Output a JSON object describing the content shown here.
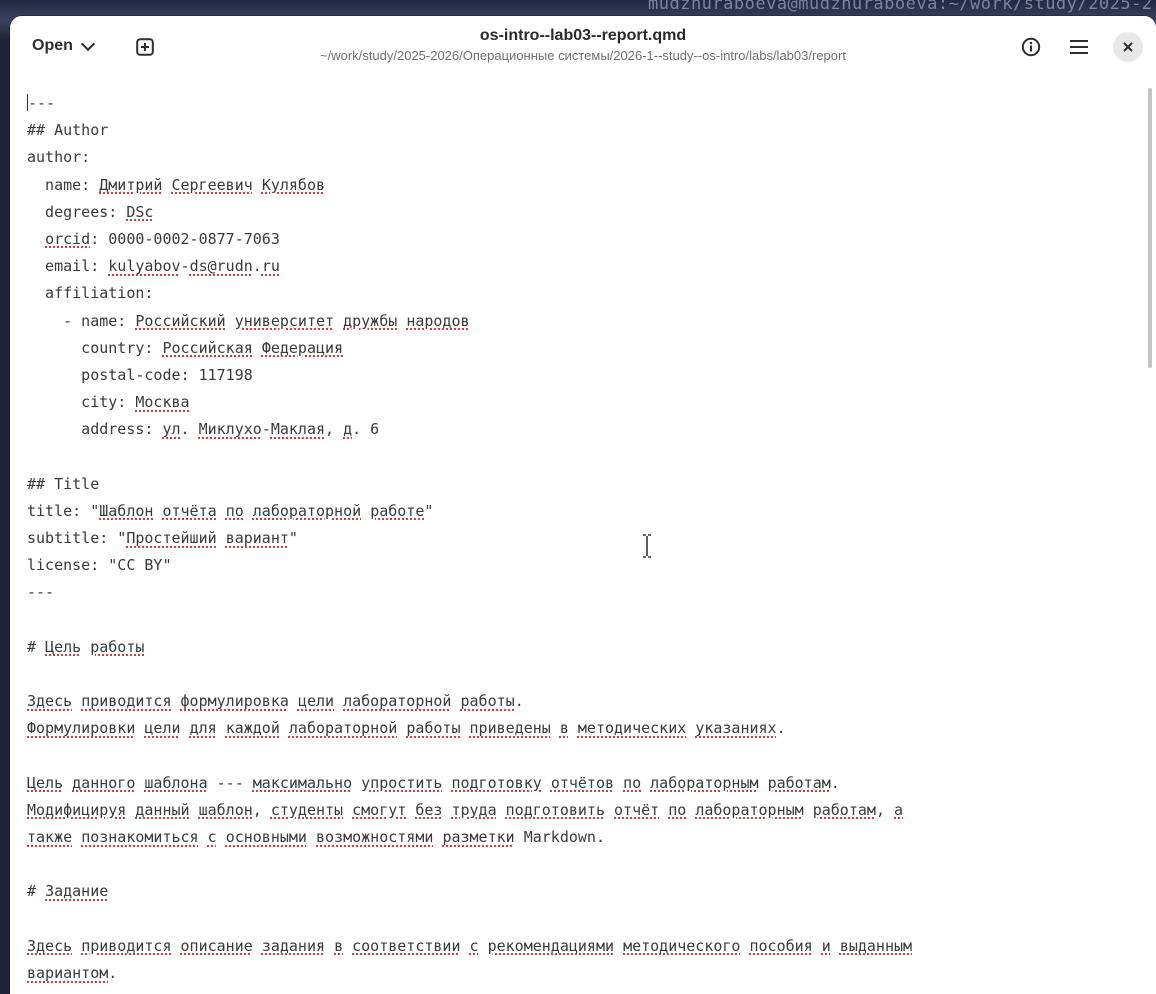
{
  "background_terminal_text": "mudzhuraboeva@mudzhuraboeva:~/work/study/2025-2",
  "header": {
    "open_label": "Open",
    "title": "os-intro--lab03--report.qmd",
    "path": "~/work/study/2025-2026/Операционные системы/2026-1--study--os-intro/labs/lab03/report"
  },
  "icons": {
    "new_tab": "plus-square-icon",
    "info": "info-icon",
    "menu": "hamburger-menu-icon",
    "close": "close-icon",
    "chevron": "chevron-down-icon"
  },
  "colors": {
    "spell_underline": "#d43b3b",
    "text": "#3a3a3a"
  },
  "editor": {
    "lines": [
      [
        {
          "t": "---"
        }
      ],
      [
        {
          "t": "## Author"
        }
      ],
      [
        {
          "t": "author:"
        }
      ],
      [
        {
          "t": "  name: "
        },
        {
          "t": "Дмитрий",
          "s": 1
        },
        {
          "t": " "
        },
        {
          "t": "Сергеевич",
          "s": 1
        },
        {
          "t": " "
        },
        {
          "t": "Кулябов",
          "s": 1
        }
      ],
      [
        {
          "t": "  degrees: "
        },
        {
          "t": "DSc",
          "s": 1
        }
      ],
      [
        {
          "t": "  "
        },
        {
          "t": "orcid",
          "s": 1
        },
        {
          "t": ": 0000-0002-0877-7063"
        }
      ],
      [
        {
          "t": "  email: "
        },
        {
          "t": "kulyabov",
          "s": 1
        },
        {
          "t": "-"
        },
        {
          "t": "ds@rudn",
          "s": 1
        },
        {
          "t": "."
        },
        {
          "t": "ru",
          "s": 1
        }
      ],
      [
        {
          "t": "  affiliation:"
        }
      ],
      [
        {
          "t": "    - name: "
        },
        {
          "t": "Российский",
          "s": 1
        },
        {
          "t": " "
        },
        {
          "t": "университет",
          "s": 1
        },
        {
          "t": " "
        },
        {
          "t": "дружбы",
          "s": 1
        },
        {
          "t": " "
        },
        {
          "t": "народов",
          "s": 1
        }
      ],
      [
        {
          "t": "      country: "
        },
        {
          "t": "Российская",
          "s": 1
        },
        {
          "t": " "
        },
        {
          "t": "Федерация",
          "s": 1
        }
      ],
      [
        {
          "t": "      postal-code: 117198"
        }
      ],
      [
        {
          "t": "      city: "
        },
        {
          "t": "Москва",
          "s": 1
        }
      ],
      [
        {
          "t": "      address: "
        },
        {
          "t": "ул",
          "s": 1
        },
        {
          "t": ". "
        },
        {
          "t": "Миклухо",
          "s": 1
        },
        {
          "t": "-"
        },
        {
          "t": "Маклая",
          "s": 1
        },
        {
          "t": ", "
        },
        {
          "t": "д",
          "s": 1
        },
        {
          "t": ". 6"
        }
      ],
      [
        {
          "t": ""
        }
      ],
      [
        {
          "t": "## Title"
        }
      ],
      [
        {
          "t": "title: \""
        },
        {
          "t": "Шаблон",
          "s": 1
        },
        {
          "t": " "
        },
        {
          "t": "отчёта",
          "s": 1
        },
        {
          "t": " "
        },
        {
          "t": "по",
          "s": 1
        },
        {
          "t": " "
        },
        {
          "t": "лабораторной",
          "s": 1
        },
        {
          "t": " "
        },
        {
          "t": "работе",
          "s": 1
        },
        {
          "t": "\""
        }
      ],
      [
        {
          "t": "subtitle: \""
        },
        {
          "t": "Простейший",
          "s": 1
        },
        {
          "t": " "
        },
        {
          "t": "вариант",
          "s": 1
        },
        {
          "t": "\""
        }
      ],
      [
        {
          "t": "license: \"CC BY\""
        }
      ],
      [
        {
          "t": "---"
        }
      ],
      [
        {
          "t": ""
        }
      ],
      [
        {
          "t": "# "
        },
        {
          "t": "Цель",
          "s": 1
        },
        {
          "t": " "
        },
        {
          "t": "работы",
          "s": 1
        }
      ],
      [
        {
          "t": ""
        }
      ],
      [
        {
          "t": "Здесь",
          "s": 1
        },
        {
          "t": " "
        },
        {
          "t": "приводится",
          "s": 1
        },
        {
          "t": " "
        },
        {
          "t": "формулировка",
          "s": 1
        },
        {
          "t": " "
        },
        {
          "t": "цели",
          "s": 1
        },
        {
          "t": " "
        },
        {
          "t": "лабораторной",
          "s": 1
        },
        {
          "t": " "
        },
        {
          "t": "работы",
          "s": 1
        },
        {
          "t": "."
        }
      ],
      [
        {
          "t": "Формулировки",
          "s": 1
        },
        {
          "t": " "
        },
        {
          "t": "цели",
          "s": 1
        },
        {
          "t": " "
        },
        {
          "t": "для",
          "s": 1
        },
        {
          "t": " "
        },
        {
          "t": "каждой",
          "s": 1
        },
        {
          "t": " "
        },
        {
          "t": "лабораторной",
          "s": 1
        },
        {
          "t": " "
        },
        {
          "t": "работы",
          "s": 1
        },
        {
          "t": " "
        },
        {
          "t": "приведены",
          "s": 1
        },
        {
          "t": " "
        },
        {
          "t": "в",
          "s": 1
        },
        {
          "t": " "
        },
        {
          "t": "методических",
          "s": 1
        },
        {
          "t": " "
        },
        {
          "t": "указаниях",
          "s": 1
        },
        {
          "t": "."
        }
      ],
      [
        {
          "t": ""
        }
      ],
      [
        {
          "t": "Цель",
          "s": 1
        },
        {
          "t": " "
        },
        {
          "t": "данного",
          "s": 1
        },
        {
          "t": " "
        },
        {
          "t": "шаблона",
          "s": 1
        },
        {
          "t": " --- "
        },
        {
          "t": "максимально",
          "s": 1
        },
        {
          "t": " "
        },
        {
          "t": "упростить",
          "s": 1
        },
        {
          "t": " "
        },
        {
          "t": "подготовку",
          "s": 1
        },
        {
          "t": " "
        },
        {
          "t": "отчётов",
          "s": 1
        },
        {
          "t": " "
        },
        {
          "t": "по",
          "s": 1
        },
        {
          "t": " "
        },
        {
          "t": "лабораторным",
          "s": 1
        },
        {
          "t": " "
        },
        {
          "t": "работам",
          "s": 1
        },
        {
          "t": "."
        }
      ],
      [
        {
          "t": "Модифицируя",
          "s": 1
        },
        {
          "t": " "
        },
        {
          "t": "данный",
          "s": 1
        },
        {
          "t": " "
        },
        {
          "t": "шаблон",
          "s": 1
        },
        {
          "t": ", "
        },
        {
          "t": "студенты",
          "s": 1
        },
        {
          "t": " "
        },
        {
          "t": "смогут",
          "s": 1
        },
        {
          "t": " "
        },
        {
          "t": "без",
          "s": 1
        },
        {
          "t": " "
        },
        {
          "t": "труда",
          "s": 1
        },
        {
          "t": " "
        },
        {
          "t": "подготовить",
          "s": 1
        },
        {
          "t": " "
        },
        {
          "t": "отчёт",
          "s": 1
        },
        {
          "t": " "
        },
        {
          "t": "по",
          "s": 1
        },
        {
          "t": " "
        },
        {
          "t": "лабораторным",
          "s": 1
        },
        {
          "t": " "
        },
        {
          "t": "работам",
          "s": 1
        },
        {
          "t": ", "
        },
        {
          "t": "а",
          "s": 1
        }
      ],
      [
        {
          "t": "также",
          "s": 1
        },
        {
          "t": " "
        },
        {
          "t": "познакомиться",
          "s": 1
        },
        {
          "t": " "
        },
        {
          "t": "с",
          "s": 1
        },
        {
          "t": " "
        },
        {
          "t": "основными",
          "s": 1
        },
        {
          "t": " "
        },
        {
          "t": "возможностями",
          "s": 1
        },
        {
          "t": " "
        },
        {
          "t": "разметки",
          "s": 1
        },
        {
          "t": " Markdown."
        }
      ],
      [
        {
          "t": ""
        }
      ],
      [
        {
          "t": "# "
        },
        {
          "t": "Задание",
          "s": 1
        }
      ],
      [
        {
          "t": ""
        }
      ],
      [
        {
          "t": "Здесь",
          "s": 1
        },
        {
          "t": " "
        },
        {
          "t": "приводится",
          "s": 1
        },
        {
          "t": " "
        },
        {
          "t": "описание",
          "s": 1
        },
        {
          "t": " "
        },
        {
          "t": "задания",
          "s": 1
        },
        {
          "t": " "
        },
        {
          "t": "в",
          "s": 1
        },
        {
          "t": " "
        },
        {
          "t": "соответствии",
          "s": 1
        },
        {
          "t": " "
        },
        {
          "t": "с",
          "s": 1
        },
        {
          "t": " "
        },
        {
          "t": "рекомендациями",
          "s": 1
        },
        {
          "t": " "
        },
        {
          "t": "методического",
          "s": 1
        },
        {
          "t": " "
        },
        {
          "t": "пособия",
          "s": 1
        },
        {
          "t": " "
        },
        {
          "t": "и",
          "s": 1
        },
        {
          "t": " "
        },
        {
          "t": "выданным",
          "s": 1
        }
      ],
      [
        {
          "t": "вариантом",
          "s": 1
        },
        {
          "t": "."
        }
      ]
    ]
  }
}
